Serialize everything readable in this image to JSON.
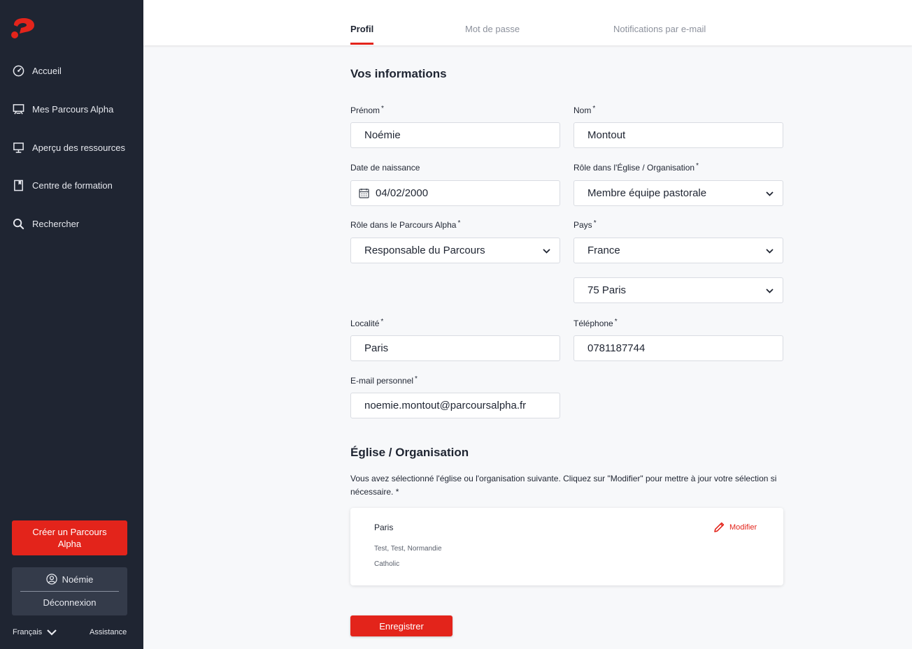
{
  "sidebar": {
    "logo_icon": "alpha-logo-icon",
    "items": [
      {
        "label": "Accueil",
        "icon": "dashboard-icon"
      },
      {
        "label": "Mes Parcours Alpha",
        "icon": "presentation-icon"
      },
      {
        "label": "Aperçu des ressources",
        "icon": "easel-icon"
      },
      {
        "label": "Centre de formation",
        "icon": "book-icon"
      },
      {
        "label": "Rechercher",
        "icon": "search-icon"
      }
    ],
    "create_button": "Créer un Parcours Alpha",
    "user_name": "Noémie",
    "logout": "Déconnexion",
    "language": "Français",
    "assistance": "Assistance"
  },
  "tabs": [
    {
      "label": "Profil",
      "active": true
    },
    {
      "label": "Mot de passe",
      "active": false
    },
    {
      "label": "Notifications par e-mail",
      "active": false
    }
  ],
  "form": {
    "section_title": "Vos informations",
    "required_mark": "*",
    "first_name": {
      "label": "Prénom",
      "value": "Noémie"
    },
    "last_name": {
      "label": "Nom",
      "value": "Montout"
    },
    "birth_date": {
      "label": "Date de naissance",
      "value": "04/02/2000"
    },
    "church_role": {
      "label": "Rôle dans l'Église / Organisation",
      "value": "Membre équipe pastorale"
    },
    "course_role": {
      "label": "Rôle dans le Parcours Alpha",
      "value": "Responsable du Parcours"
    },
    "country": {
      "label": "Pays",
      "value": "France"
    },
    "region": {
      "value": "75 Paris"
    },
    "locality": {
      "label": "Localité",
      "value": "Paris"
    },
    "phone": {
      "label": "Téléphone",
      "value": "0781187744"
    },
    "email": {
      "label": "E-mail personnel",
      "value": "noemie.montout@parcoursalpha.fr"
    }
  },
  "church": {
    "section_title": "Église / Organisation",
    "description": "Vous avez sélectionné l'église ou l'organisation suivante. Cliquez sur \"Modifier\" pour mettre à jour votre sélection si nécessaire. *",
    "card": {
      "name": "Paris",
      "address": "Test, Test, Normandie",
      "denomination": "Catholic",
      "modify_label": "Modifier"
    }
  },
  "save_button": "Enregistrer",
  "colors": {
    "accent": "#e3241b",
    "sidebar": "#1f2532"
  }
}
